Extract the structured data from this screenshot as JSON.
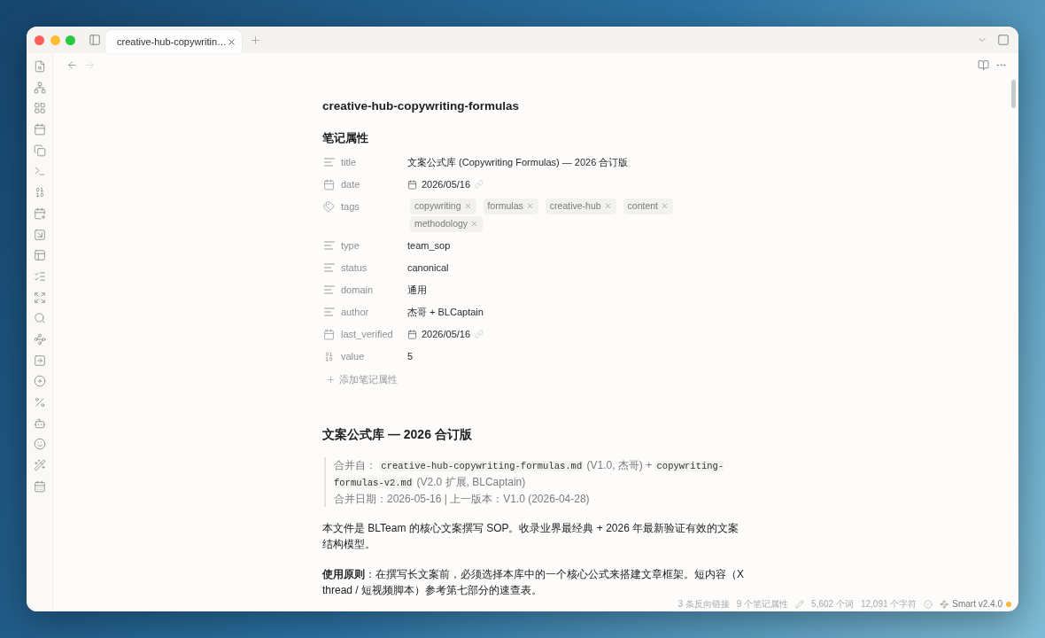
{
  "window": {
    "tab": {
      "title": "creative-hub-copywritin…"
    }
  },
  "document": {
    "title": "creative-hub-copywriting-formulas",
    "properties_heading": "笔记属性",
    "properties": [
      {
        "kind": "text",
        "name": "title",
        "value": "文案公式库 (Copywriting Formulas) — 2026 合订版"
      },
      {
        "kind": "date",
        "name": "date",
        "value": "2026/05/16"
      },
      {
        "kind": "tags",
        "name": "tags",
        "tags": [
          "copywriting",
          "formulas",
          "creative-hub",
          "content",
          "methodology"
        ]
      },
      {
        "kind": "text",
        "name": "type",
        "value": "team_sop"
      },
      {
        "kind": "text",
        "name": "status",
        "value": "canonical"
      },
      {
        "kind": "text",
        "name": "domain",
        "value": "通用"
      },
      {
        "kind": "text",
        "name": "author",
        "value": "杰哥 + BLCaptain"
      },
      {
        "kind": "date",
        "name": "last_verified",
        "value": "2026/05/16"
      },
      {
        "kind": "number",
        "name": "value",
        "value": "5"
      }
    ],
    "add_property": "添加笔记属性",
    "heading": "文案公式库 — 2026 合订版",
    "quote": [
      [
        {
          "kind": "text",
          "text": "合并自： "
        },
        {
          "kind": "code",
          "text": "creative-hub-copywriting-formulas.md"
        },
        {
          "kind": "text",
          "text": " (V1.0, 杰哥) + "
        },
        {
          "kind": "code",
          "text": "copywriting-formulas-v2.md"
        },
        {
          "kind": "text",
          "text": " (V2.0 扩展, BLCaptain)"
        }
      ],
      [
        {
          "kind": "text",
          "text": "合并日期：2026-05-16 | 上一版本：V1.0 (2026-04-28)"
        }
      ]
    ],
    "paragraphs": [
      "本文件是 BLTeam 的核心文案撰写 SOP。收录业界最经典 + 2026 年最新验证有效的文案结构模型。",
      "**使用原则**：在撰写长文案前，必须选择本库中的一个核心公式来搭建文章框架。短内容（X thread / 短视频脚本）参考第七部分的速查表。"
    ]
  },
  "status_bar": {
    "backlinks": "3 条反向链接",
    "properties": "9 个笔记属性",
    "words": "5,602 个词",
    "characters": "12,091 个字符",
    "plugin": "Smart v2.4.0"
  }
}
